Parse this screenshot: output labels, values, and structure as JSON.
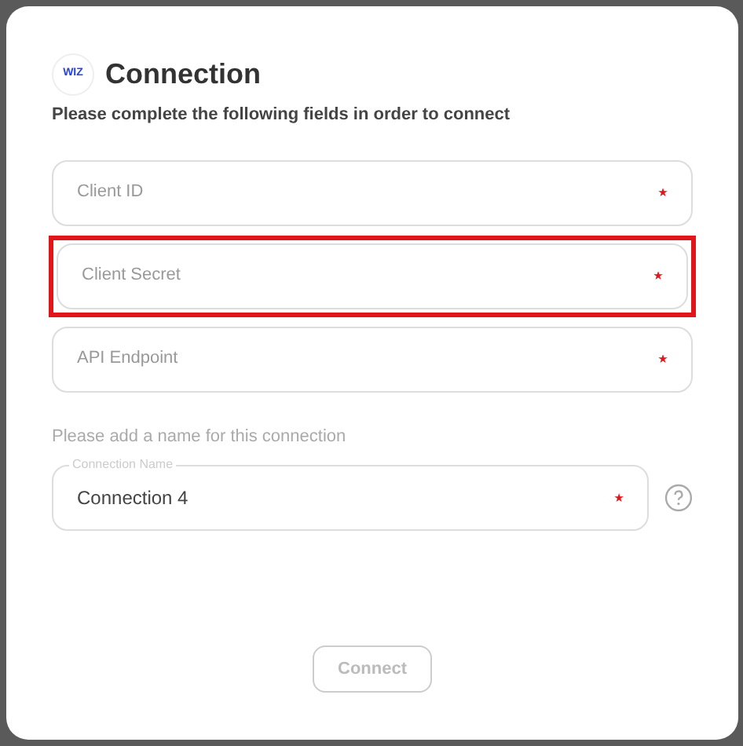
{
  "dialog": {
    "logo": "WIZ",
    "title": "Connection",
    "subtitle": "Please complete the following fields in order to connect"
  },
  "fields": [
    {
      "placeholder": "Client ID",
      "required": true,
      "highlighted": false
    },
    {
      "placeholder": "Client Secret",
      "required": true,
      "highlighted": true
    },
    {
      "placeholder": "API Endpoint",
      "required": true,
      "highlighted": false
    }
  ],
  "name_section": {
    "prompt": "Please add a name for this connection",
    "field": {
      "label": "Connection Name",
      "value": "Connection 4",
      "required": true
    }
  },
  "connect_button": {
    "label": "Connect",
    "disabled": true
  }
}
